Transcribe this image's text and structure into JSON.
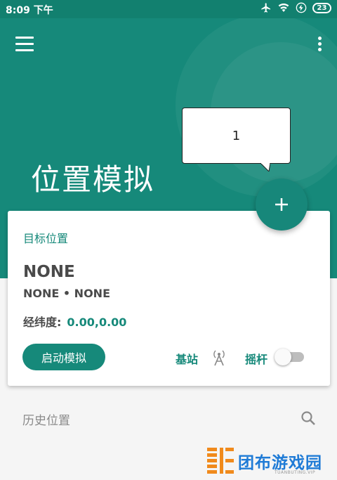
{
  "status_bar": {
    "time": "8:09 下午",
    "battery": "23"
  },
  "app": {
    "title": "位置模拟"
  },
  "tooltip": {
    "text": "1"
  },
  "fab": {
    "label": "+"
  },
  "card": {
    "header": "目标位置",
    "name": "NONE",
    "subtitle": "NONE • NONE",
    "coord_label": "经纬度:",
    "coord_value": "0.00,0.00",
    "start_button": "启动模拟",
    "base_station_label": "基站",
    "joystick_label": "摇杆"
  },
  "history": {
    "label": "历史位置"
  },
  "watermark": {
    "text": "团布游戏园",
    "sub": "TUANBUTING.VIP"
  },
  "colors": {
    "primary": "#16897a",
    "status": "#12806f",
    "background": "#f5f5f5"
  },
  "icons": [
    "airplane-icon",
    "wifi-icon",
    "charging-icon",
    "battery-icon",
    "menu-icon",
    "more-vert-icon",
    "add-icon",
    "antenna-icon",
    "search-icon"
  ]
}
